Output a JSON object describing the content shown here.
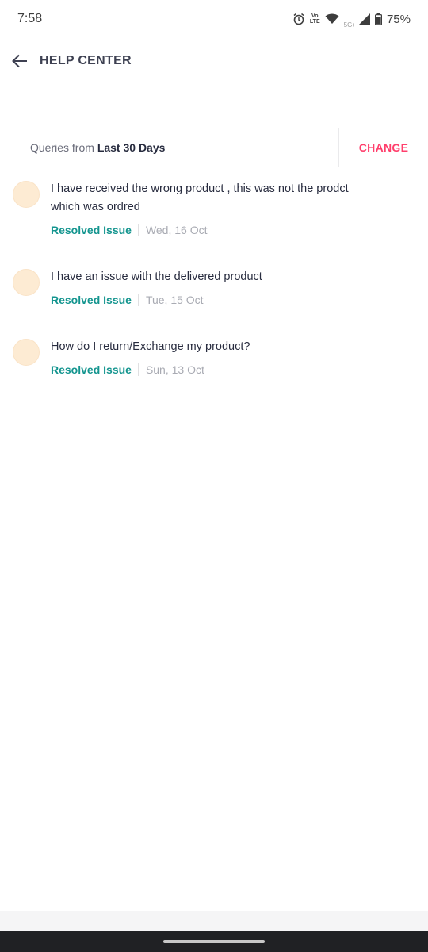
{
  "status_bar": {
    "time": "7:58",
    "volte_top": "Vo",
    "volte_bottom": "LTE",
    "network": "5G+",
    "battery": "75%"
  },
  "header": {
    "title": "HELP CENTER"
  },
  "filter": {
    "prefix": "Queries from",
    "period": "Last 30 Days",
    "change_label": "CHANGE"
  },
  "queries": [
    {
      "title": "I have received the wrong product , this was not the prodct which was ordred",
      "status": "Resolved Issue",
      "date": "Wed, 16 Oct"
    },
    {
      "title": "I have an issue with the delivered product",
      "status": "Resolved Issue",
      "date": "Tue, 15 Oct"
    },
    {
      "title": "How do I return/Exchange my product?",
      "status": "Resolved Issue",
      "date": "Sun, 13 Oct"
    }
  ],
  "colors": {
    "accent": "#ff3f6c",
    "resolved": "#14958f",
    "avatar": "#fdebd3"
  }
}
